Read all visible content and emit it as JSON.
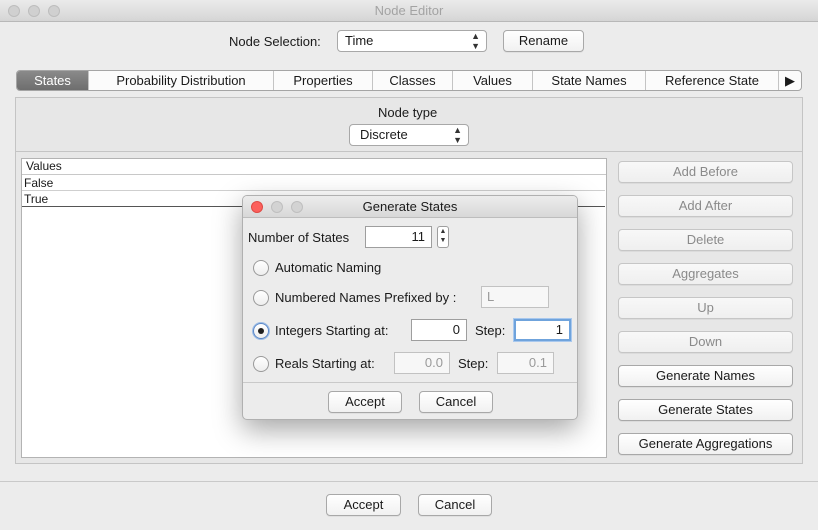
{
  "window": {
    "title": "Node Editor"
  },
  "header": {
    "node_selection_label": "Node Selection:",
    "node_selection_value": "Time",
    "rename_label": "Rename"
  },
  "tabs": [
    {
      "label": "States"
    },
    {
      "label": "Probability Distribution"
    },
    {
      "label": "Properties"
    },
    {
      "label": "Classes"
    },
    {
      "label": "Values"
    },
    {
      "label": "State Names"
    },
    {
      "label": "Reference State"
    }
  ],
  "tab_more_icon": "▶",
  "node_type": {
    "label": "Node type",
    "value": "Discrete"
  },
  "states_list": {
    "header": "Values",
    "rows": [
      "False",
      "True"
    ]
  },
  "side_buttons": {
    "add_before": "Add Before",
    "add_after": "Add After",
    "delete": "Delete",
    "aggregates": "Aggregates",
    "up": "Up",
    "down": "Down",
    "generate_names": "Generate Names",
    "generate_states": "Generate States",
    "generate_aggregations": "Generate Aggregations"
  },
  "footer": {
    "accept": "Accept",
    "cancel": "Cancel"
  },
  "dialog": {
    "title": "Generate States",
    "number_of_states_label": "Number of States",
    "number_of_states_value": "11",
    "automatic_naming": "Automatic Naming",
    "numbered_names_label": "Numbered Names Prefixed by :",
    "numbered_names_placeholder": "L",
    "integers_label": "Integers Starting at:",
    "integers_start": "0",
    "integers_step_label": "Step:",
    "integers_step": "1",
    "reals_label": "Reals Starting at:",
    "reals_start": "0.0",
    "reals_step_label": "Step:",
    "reals_step": "0.1",
    "accept": "Accept",
    "cancel": "Cancel",
    "selected_option": "Integers Starting at:"
  },
  "colors": {
    "close_red": "#fc605c",
    "active_tab": "#7a7a7a",
    "focus_blue": "#6fa3dc"
  }
}
